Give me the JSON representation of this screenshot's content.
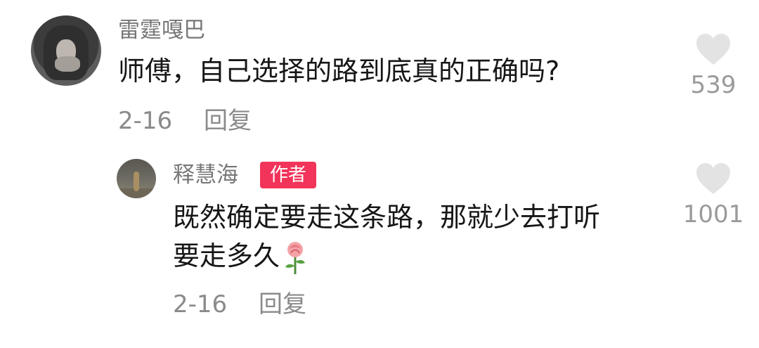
{
  "comment": {
    "username": "雷霆嘎巴",
    "text": "师傅，自己选择的路到底真的正确吗?",
    "date": "2-16",
    "reply_label": "回复",
    "likes": "539",
    "avatar_icon": "user-avatar-hooded-person"
  },
  "reply": {
    "username": "释慧海",
    "badge": "作者",
    "text_line1": "既然确定要走这条路，那就少去打听",
    "text_line2": "要走多久",
    "emoji_icon": "rose-icon",
    "date": "2-16",
    "reply_label": "回复",
    "likes": "1001",
    "avatar_icon": "user-avatar-landscape"
  },
  "colors": {
    "badge_bg": "#f2345a",
    "heart": "#e3e3e3",
    "muted_text": "#8a8a8a"
  }
}
